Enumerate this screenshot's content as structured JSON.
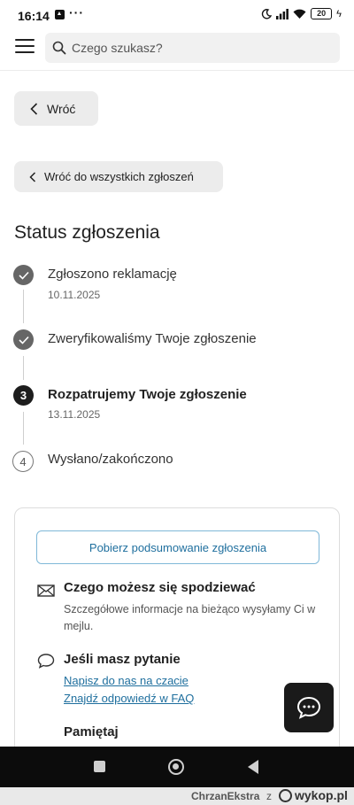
{
  "status_bar": {
    "time": "16:14",
    "battery": "20",
    "dots": "···"
  },
  "search": {
    "placeholder": "Czego szukasz?"
  },
  "buttons": {
    "back": "Wróć",
    "all_requests": "Wróć do wszystkich zgłoszeń"
  },
  "page_title": "Status zgłoszenia",
  "steps": [
    {
      "label": "Zgłoszono reklamację",
      "date": "10.11.2025",
      "state": "done"
    },
    {
      "label": "Zweryfikowaliśmy Twoje zgłoszenie",
      "date": "",
      "state": "done"
    },
    {
      "number": "3",
      "label": "Rozpatrujemy Twoje zgłoszenie",
      "date": "13.11.2025",
      "state": "current"
    },
    {
      "number": "4",
      "label": "Wysłano/zakończono",
      "date": "",
      "state": "todo"
    }
  ],
  "card": {
    "download_button": "Pobierz podsumowanie zgłoszenia",
    "expect_title": "Czego możesz się spodziewać",
    "expect_text": "Szczegółowe informacje na bieżąco wysyłamy Ci w mejlu.",
    "question_title": "Jeśli masz pytanie",
    "link_chat": "Napisz do nas na czacie",
    "link_faq": "Znajdź odpowiedź w FAQ",
    "remember_title": "Pamiętaj"
  },
  "watermark": {
    "user": "ChrzanEkstra",
    "separator": "z",
    "site": "wykop.pl"
  },
  "colors": {
    "accent_link": "#1f6f9e",
    "download_border": "#7fb8d8",
    "step_done": "#666666",
    "step_current": "#1d1d1d"
  },
  "icons": [
    "hamburger-menu-icon",
    "search-icon",
    "chevron-left-icon",
    "check-icon",
    "envelope-icon",
    "chat-bubble-icon"
  ]
}
